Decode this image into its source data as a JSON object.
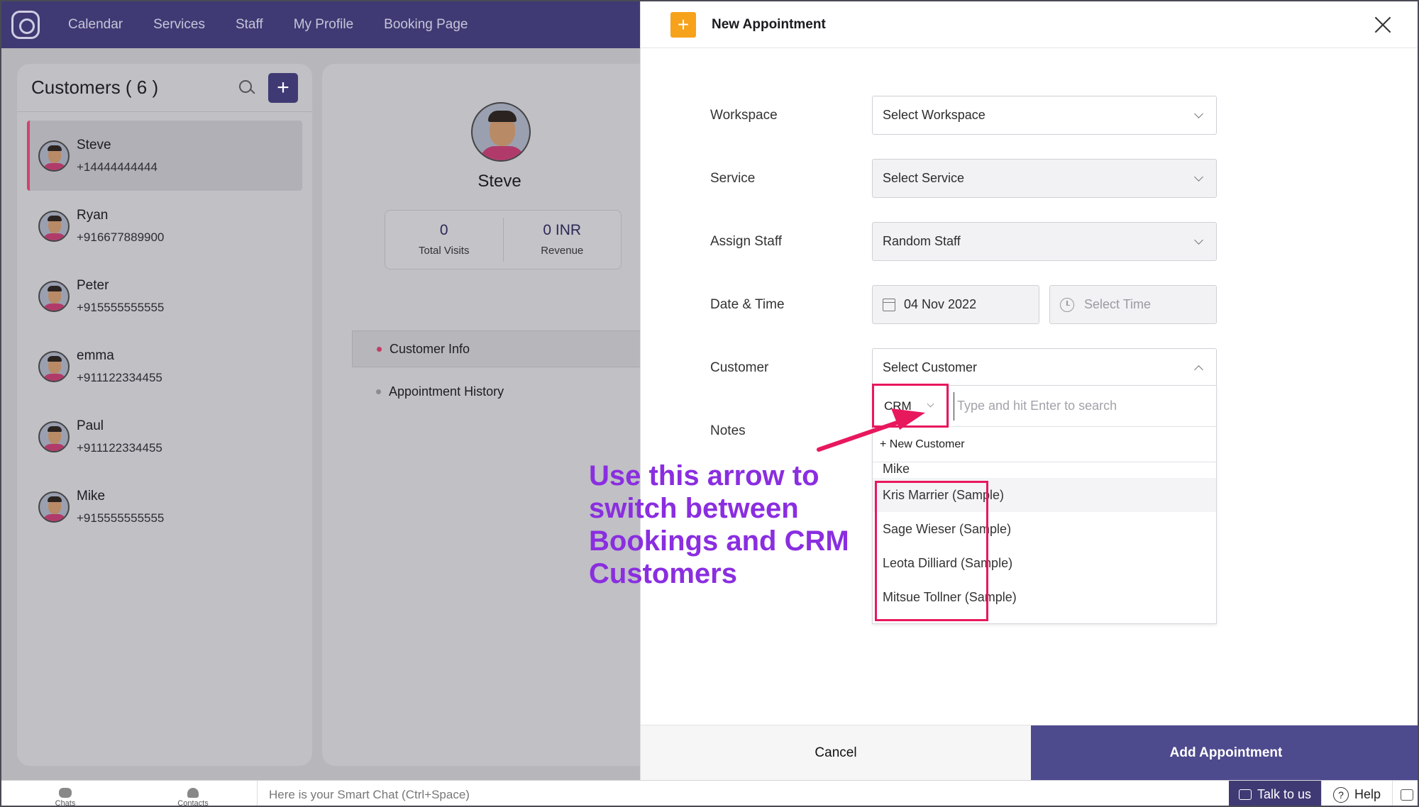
{
  "nav": {
    "items": [
      "Calendar",
      "Services",
      "Staff",
      "My Profile",
      "Booking Page"
    ]
  },
  "customers": {
    "title": "Customers ( 6 )",
    "add_label": "+",
    "list": [
      {
        "name": "Steve",
        "phone": "+14444444444"
      },
      {
        "name": "Ryan",
        "phone": "+916677889900"
      },
      {
        "name": "Peter",
        "phone": "+915555555555"
      },
      {
        "name": "emma",
        "phone": "+911122334455"
      },
      {
        "name": "Paul",
        "phone": "+911122334455"
      },
      {
        "name": "Mike",
        "phone": "+915555555555"
      }
    ]
  },
  "detail": {
    "name": "Steve",
    "stats": [
      {
        "value": "0",
        "label": "Total Visits"
      },
      {
        "value": "0 INR",
        "label": "Revenue"
      }
    ],
    "tabs": [
      "Customer Info",
      "Appointment History"
    ]
  },
  "modal": {
    "plus": "+",
    "title": "New Appointment",
    "fields": {
      "workspace_label": "Workspace",
      "workspace_value": "Select Workspace",
      "service_label": "Service",
      "service_value": "Select Service",
      "staff_label": "Assign Staff",
      "staff_value": "Random Staff",
      "datetime_label": "Date & Time",
      "date_value": "04 Nov 2022",
      "time_placeholder": "Select Time",
      "customer_label": "Customer",
      "customer_value": "Select Customer",
      "notes_label": "Notes"
    },
    "dropdown": {
      "source": "CRM",
      "search_placeholder": "Type and hit Enter to search",
      "new_customer": "+ New Customer",
      "partial_item": "Mike",
      "items": [
        "Kris Marrier (Sample)",
        "Sage Wieser (Sample)",
        "Leota Dilliard (Sample)",
        "Mitsue Tollner (Sample)"
      ]
    },
    "cancel_label": "Cancel",
    "add_label": "Add Appointment"
  },
  "annotation": {
    "lines": [
      "Use this arrow to",
      "switch between",
      "Bookings and CRM",
      "Customers"
    ],
    "color": "#8a2ee0",
    "highlight_color": "#e8185d"
  },
  "bottombar": {
    "chats": "Chats",
    "contacts": "Contacts",
    "smart_chat": "Here is your Smart Chat (Ctrl+Space)",
    "talk": "Talk to us",
    "help": "Help"
  },
  "colors": {
    "brand": "#3f3a73",
    "primary_button": "#4e4a8e",
    "accent_plus": "#f7a21b",
    "active_marker": "#d4416b"
  }
}
